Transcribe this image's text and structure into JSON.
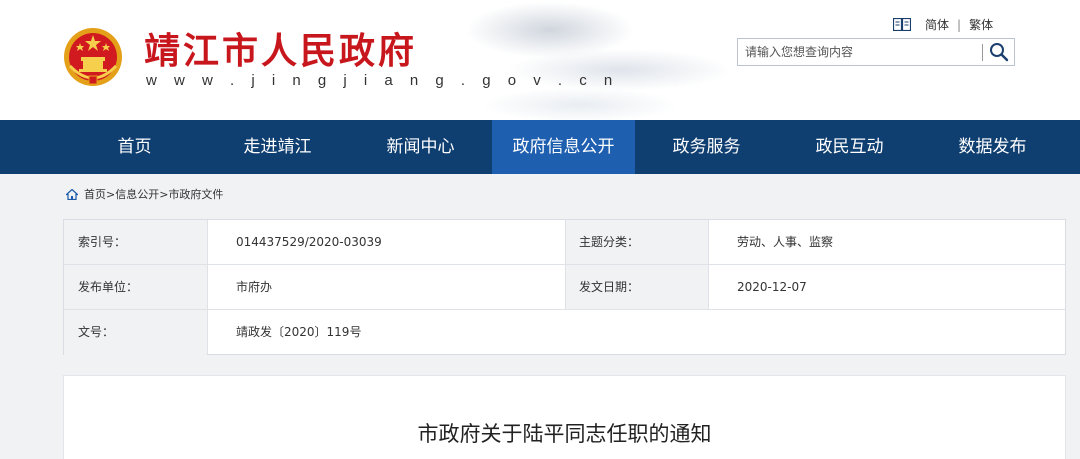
{
  "site": {
    "title": "靖江市人民政府",
    "url": "w w w . j i n g j i a n g . g o v . c n"
  },
  "lang": {
    "simplified": "简体",
    "separator": "|",
    "traditional": "繁体"
  },
  "search": {
    "placeholder": "请输入您想查询内容"
  },
  "nav": {
    "items": [
      {
        "label": "首页"
      },
      {
        "label": "走进靖江"
      },
      {
        "label": "新闻中心"
      },
      {
        "label": "政府信息公开"
      },
      {
        "label": "政务服务"
      },
      {
        "label": "政民互动"
      },
      {
        "label": "数据发布"
      }
    ],
    "active_index": 3
  },
  "breadcrumb": {
    "items": [
      "首页",
      "信息公开",
      "市政府文件"
    ],
    "separator": ">"
  },
  "meta": {
    "index_label": "索引号：",
    "index_value": "014437529/2020-03039",
    "topic_label": "主题分类：",
    "topic_value": "劳动、人事、监察",
    "publisher_label": "发布单位：",
    "publisher_value": "市府办",
    "date_label": "发文日期：",
    "date_value": "2020-12-07",
    "docno_label": "文号：",
    "docno_value": "靖政发〔2020〕119号"
  },
  "document": {
    "title": "市政府关于陆平同志任职的通知"
  },
  "colors": {
    "brand_red": "#c8161d",
    "nav_bg": "#0f3e70",
    "nav_active": "#1e5fb0"
  },
  "icons": {
    "emblem": "national-emblem-icon",
    "lang": "book-icon",
    "search": "search-icon",
    "home": "home-icon"
  }
}
